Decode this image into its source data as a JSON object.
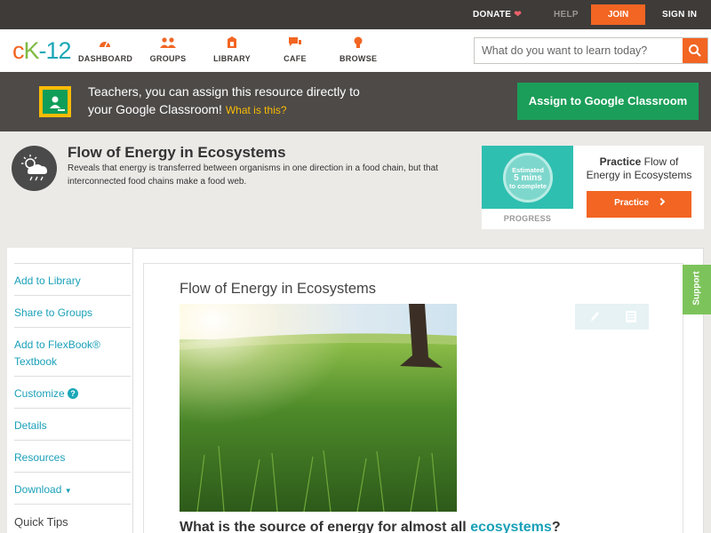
{
  "topbar": {
    "donate": "DONATE",
    "help": "HELP",
    "join": "JOIN",
    "signin": "SIGN IN"
  },
  "nav": {
    "logo_c": "c",
    "logo_k": "K",
    "logo_dash": "-",
    "logo_12": "12",
    "items": [
      {
        "label": "DASHBOARD",
        "icon": "dashboard-icon"
      },
      {
        "label": "GROUPS",
        "icon": "groups-icon"
      },
      {
        "label": "LIBRARY",
        "icon": "library-icon"
      },
      {
        "label": "CAFE",
        "icon": "cafe-icon"
      },
      {
        "label": "BROWSE",
        "icon": "browse-icon"
      }
    ],
    "search_placeholder": "What do you want to learn today?"
  },
  "banner": {
    "line1": "Teachers, you can assign this resource directly to",
    "line2": "your Google Classroom!",
    "what": "What is this?",
    "assign": "Assign to Google Classroom"
  },
  "concept": {
    "title": "Flow of Energy in Ecosystems",
    "description": "Reveals that energy is transferred between organisms in one direction in a food chain, but that interconnected food chains make a food web."
  },
  "practice": {
    "estimated": "Estimated",
    "mins": "5 mins",
    "to_complete": "to complete",
    "progress": "PROGRESS",
    "practice_word": "Practice",
    "title_rest": "Flow of Energy in Ecosystems",
    "button": "Practice"
  },
  "sidebar": {
    "items": [
      {
        "label": "Add to Library"
      },
      {
        "label": "Share to Groups"
      },
      {
        "label": "Add to FlexBook® Textbook"
      },
      {
        "label": "Customize"
      },
      {
        "label": "Details"
      },
      {
        "label": "Resources"
      },
      {
        "label": "Download"
      },
      {
        "label": "Quick Tips"
      }
    ]
  },
  "lesson": {
    "title": "Flow of Energy in Ecosystems",
    "question_pre": "What is the source of energy for almost all",
    "question_link": "ecosystems",
    "question_post": "?"
  },
  "support": "Support",
  "colors": {
    "accent_orange": "#f26522",
    "teal": "#1aa7b8",
    "google_green": "#1b9e59",
    "support_green": "#7dc35b"
  }
}
